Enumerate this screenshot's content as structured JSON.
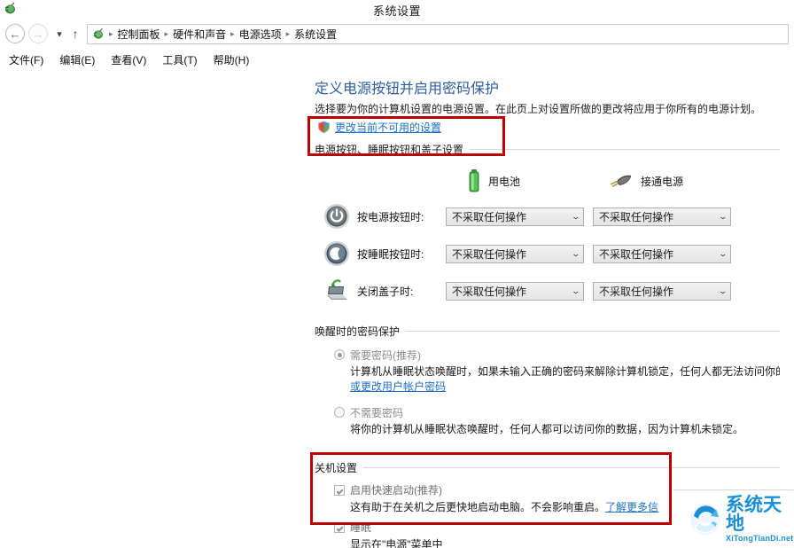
{
  "window": {
    "title": "系统设置",
    "icon": "power-plug-icon"
  },
  "nav": {
    "back_icon": "←",
    "forward_icon": "→",
    "history_icon": "▾",
    "up_icon": "↑",
    "address_icon": "power-plug-icon",
    "breadcrumbs": [
      "控制面板",
      "硬件和声音",
      "电源选项",
      "系统设置"
    ],
    "separator": "▸"
  },
  "menubar": {
    "items": [
      "文件(F)",
      "编辑(E)",
      "查看(V)",
      "工具(T)",
      "帮助(H)"
    ]
  },
  "page": {
    "title": "定义电源按钮并启用密码保护",
    "subtitle": "选择要为你的计算机设置的电源设置。在此页上对设置所做的更改将应用于你所有的电源计划。",
    "uac_link": "更改当前不可用的设置",
    "uac_icon": "shield-icon"
  },
  "buttons_section": {
    "header": "电源按钮、睡眠按钮和盖子设置",
    "columns": [
      {
        "label": "用电池",
        "icon": "battery-icon"
      },
      {
        "label": "接通电源",
        "icon": "power-plug-icon"
      }
    ],
    "rows": [
      {
        "icon": "power-button-icon",
        "label": "按电源按钮时:",
        "battery_value": "不采取任何操作",
        "plugged_value": "不采取任何操作"
      },
      {
        "icon": "sleep-button-icon",
        "label": "按睡眠按钮时:",
        "battery_value": "不采取任何操作",
        "plugged_value": "不采取任何操作"
      },
      {
        "icon": "laptop-lid-icon",
        "label": "关闭盖子时:",
        "battery_value": "不采取任何操作",
        "plugged_value": "不采取任何操作"
      }
    ],
    "dropdown_arrow": "⌄"
  },
  "password_section": {
    "header": "唤醒时的密码保护",
    "option_required": {
      "label": "需要密码(推荐)",
      "selected": true,
      "description_before": "计算机从睡眠状态唤醒时，如果未输入正确的密码来解除计算机锁定，任何人都无法访问你的数据。",
      "link": "创建或更改用户帐户密码"
    },
    "option_not_required": {
      "label": "不需要密码",
      "selected": false,
      "description": "将你的计算机从睡眠状态唤醒时，任何人都可以访问你的数据，因为计算机未锁定。"
    }
  },
  "shutdown_section": {
    "header": "关机设置",
    "items": [
      {
        "label": "启用快速启动(推荐)",
        "checked": true,
        "description": "这有助于在关机之后更快地启动电脑。不会影响重启。",
        "link": "了解更多信"
      },
      {
        "label": "睡眠",
        "checked": true,
        "description": "显示在\"电源\"菜单中"
      }
    ]
  },
  "watermark": {
    "cn": "系统天地",
    "en": "XiTongTianDi.net",
    "color": "#1a8fd6"
  },
  "annotations": {
    "accent_color": "#c00000",
    "boxes": [
      "uac-link-highlight",
      "shutdown-settings-highlight"
    ]
  }
}
